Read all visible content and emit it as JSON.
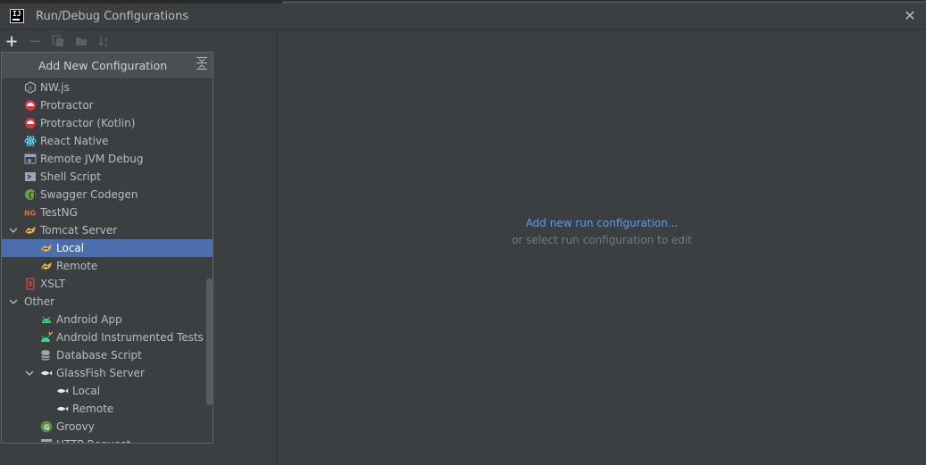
{
  "window": {
    "title": "Run/Debug Configurations",
    "app_icon": "intellij-icon",
    "close_icon": "close-icon"
  },
  "toolbar": {
    "add_icon": "plus-icon",
    "remove_icon": "minus-icon",
    "copy_icon": "copy-icon",
    "folder_icon": "folder-icon",
    "sort_icon": "sort-icon"
  },
  "popup": {
    "title": "Add New Configuration",
    "collapse_icon": "collapse-all-icon",
    "items": [
      {
        "label": "NW.js",
        "icon": "nwjs-icon",
        "level": 1,
        "color": "#9aa7b0"
      },
      {
        "label": "Protractor",
        "icon": "protractor-icon",
        "level": 1,
        "color": "#e0313a"
      },
      {
        "label": "Protractor (Kotlin)",
        "icon": "protractor-icon",
        "level": 1,
        "color": "#e0313a"
      },
      {
        "label": "React Native",
        "icon": "react-icon",
        "level": 1,
        "color": "#61dafb"
      },
      {
        "label": "Remote JVM Debug",
        "icon": "remote-debug-icon",
        "level": 1,
        "color": "#5e9bc7"
      },
      {
        "label": "Shell Script",
        "icon": "shell-icon",
        "level": 1,
        "color": "#9aa7b0"
      },
      {
        "label": "Swagger Codegen",
        "icon": "swagger-icon",
        "level": 1,
        "color": "#6a9f42"
      },
      {
        "label": "TestNG",
        "icon": "testng-icon",
        "level": 1,
        "color": "#e06c3b"
      },
      {
        "label": "Tomcat Server",
        "icon": "tomcat-icon",
        "level": 1,
        "expanded": true,
        "color": "#f0b63c"
      },
      {
        "label": "Local",
        "icon": "tomcat-icon",
        "level": 2,
        "selected": true,
        "color": "#f0b63c"
      },
      {
        "label": "Remote",
        "icon": "tomcat-icon",
        "level": 2,
        "color": "#f0b63c"
      },
      {
        "label": "XSLT",
        "icon": "xslt-icon",
        "level": 1,
        "color": "#c74444"
      },
      {
        "label": "Other",
        "icon": "",
        "level": 0,
        "expanded": true,
        "color": ""
      },
      {
        "label": "Android App",
        "icon": "android-icon",
        "level": 2,
        "color": "#3ddc84"
      },
      {
        "label": "Android Instrumented Tests",
        "icon": "android-test-icon",
        "level": 2,
        "color": "#3ddc84"
      },
      {
        "label": "Database Script",
        "icon": "database-icon",
        "level": 2,
        "color": "#9aa7b0"
      },
      {
        "label": "GlassFish Server",
        "icon": "glassfish-icon",
        "level": 2,
        "expanded": true,
        "color": "#e8e8e8"
      },
      {
        "label": "Local",
        "icon": "glassfish-icon",
        "level": 3,
        "color": "#e8e8e8"
      },
      {
        "label": "Remote",
        "icon": "glassfish-icon",
        "level": 3,
        "color": "#e8e8e8"
      },
      {
        "label": "Groovy",
        "icon": "groovy-icon",
        "level": 2,
        "color": "#5a8f3e"
      },
      {
        "label": "HTTP Request",
        "icon": "http-request-icon",
        "level": 2,
        "color": "#9aa7b0"
      }
    ]
  },
  "empty_state": {
    "link": "Add new run configuration...",
    "subtext": "or select run configuration to edit"
  },
  "colors": {
    "background": "#3c3f41",
    "selection": "#4b6eaf",
    "link": "#589df6"
  }
}
